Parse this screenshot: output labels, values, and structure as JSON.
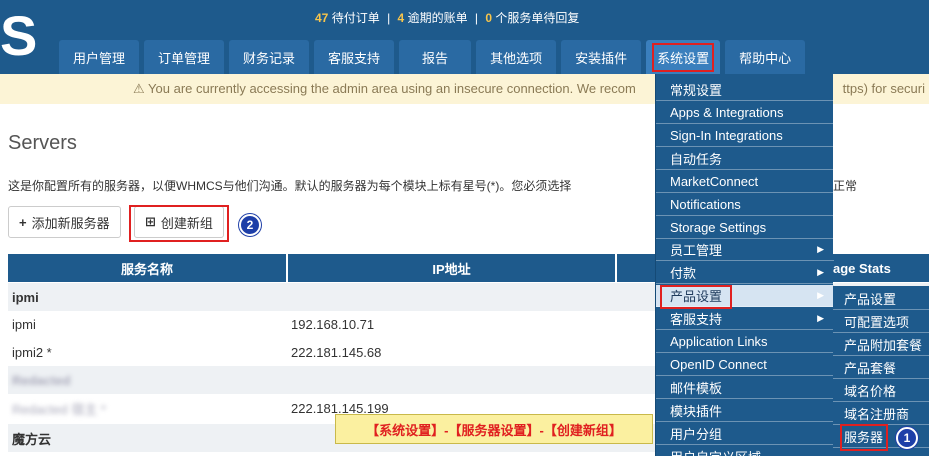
{
  "header": {
    "logo_text": "S",
    "alerts": {
      "pending_orders_count": "47",
      "pending_orders_label": "待付订单",
      "overdue_count": "4",
      "overdue_label": "逾期的账单",
      "tickets_count": "0",
      "tickets_label": "个服务单待回复",
      "separator": "|"
    },
    "nav": [
      "用户管理",
      "订单管理",
      "财务记录",
      "客服支持",
      "报告",
      "其他选项",
      "安装插件",
      "系统设置",
      "帮助中心"
    ],
    "active_tab": "系统设置"
  },
  "warning": {
    "icon": "warning-icon",
    "text": "You are currently accessing the admin area using an insecure connection. We recom",
    "tail": "ttps) for securi"
  },
  "page": {
    "title": "Servers",
    "description": "这是你配置所有的服务器，以便WHMCS与他们沟通。默认的服务器为每个模块上标有星号(*)。您必须选择",
    "description_tail": "正常",
    "add_server_label": "添加新服务器",
    "create_group_label": "创建新组"
  },
  "table": {
    "columns": [
      "服务名称",
      "IP地址",
      "",
      "age Stats"
    ],
    "rows": [
      {
        "type": "group",
        "name": "ipmi",
        "ip": ""
      },
      {
        "type": "row",
        "name": "ipmi",
        "ip": "192.168.10.71"
      },
      {
        "type": "row",
        "name": "ipmi2 *",
        "ip": "222.181.145.68"
      },
      {
        "type": "group",
        "name": "Redacted",
        "ip": ""
      },
      {
        "type": "row",
        "name": "Redacted 宿主 *",
        "ip": "222.181.145.199"
      },
      {
        "type": "group",
        "name": "魔方云",
        "ip": ""
      }
    ]
  },
  "dropdown": {
    "items": [
      {
        "label": "常规设置",
        "arrow": false
      },
      {
        "label": "Apps & Integrations",
        "arrow": false
      },
      {
        "label": "Sign-In Integrations",
        "arrow": false
      },
      {
        "label": "自动任务",
        "arrow": false
      },
      {
        "label": "MarketConnect",
        "arrow": false
      },
      {
        "label": "Notifications",
        "arrow": false
      },
      {
        "label": "Storage Settings",
        "arrow": false
      },
      {
        "label": "员工管理",
        "arrow": true
      },
      {
        "label": "付款",
        "arrow": true
      },
      {
        "label": "产品设置",
        "arrow": true,
        "highlighted": true
      },
      {
        "label": "客服支持",
        "arrow": true
      },
      {
        "label": "Application Links",
        "arrow": false
      },
      {
        "label": "OpenID Connect",
        "arrow": false
      },
      {
        "label": "邮件模板",
        "arrow": false
      },
      {
        "label": "模块插件",
        "arrow": false
      },
      {
        "label": "用户分组",
        "arrow": false
      },
      {
        "label": "用户自定义区域",
        "arrow": false
      }
    ],
    "arrow_glyph": "▶"
  },
  "submenu": {
    "items": [
      "产品设置",
      "可配置选项",
      "产品附加套餐",
      "产品套餐",
      "域名价格",
      "域名注册商",
      "服务器"
    ]
  },
  "annotations": {
    "caption": "【系统设置】-【服务器设置】-【创建新组】",
    "step1": "1",
    "step2": "2",
    "red_color": "#e02020",
    "step_color": "#1e3fa8"
  },
  "colors": {
    "brand": "#1e5a8c",
    "alert_count": "#f8c54b",
    "warning_bg": "#fcf4d6"
  }
}
